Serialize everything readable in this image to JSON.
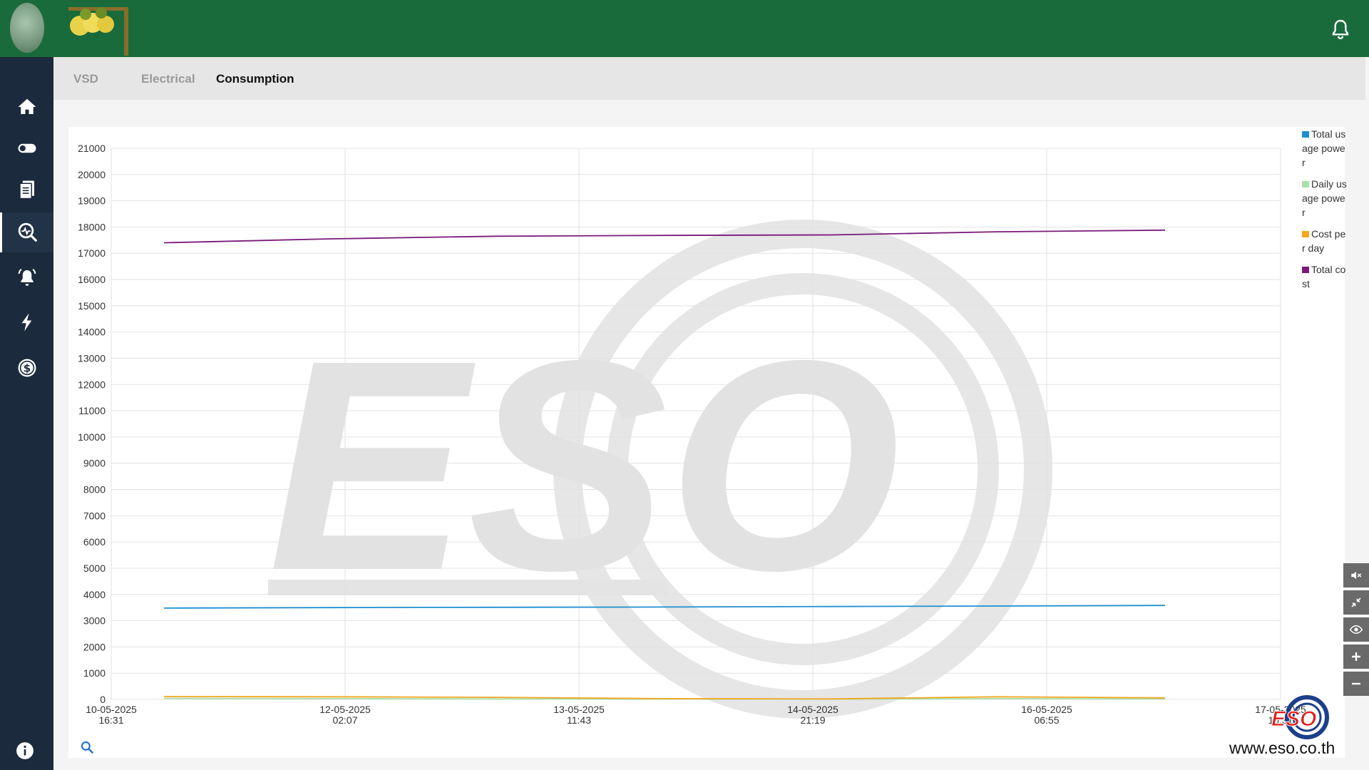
{
  "header": {
    "notifications_icon": "bell-icon",
    "colors": {
      "bar": "#1a6b3c"
    }
  },
  "sidebar": {
    "items": [
      {
        "icon": "home-icon"
      },
      {
        "icon": "toggle-icon"
      },
      {
        "icon": "document-icon"
      },
      {
        "icon": "monitor-search-icon",
        "active": true
      },
      {
        "icon": "alarm-bell-icon"
      },
      {
        "icon": "lightning-icon"
      },
      {
        "icon": "dollar-icon"
      }
    ],
    "info_icon": "info-icon"
  },
  "tabs": [
    {
      "label": "VSD",
      "active": false
    },
    {
      "label": "Electrical",
      "active": false
    },
    {
      "label": "Consumption",
      "active": true
    }
  ],
  "legend": [
    {
      "label": "Total usage power",
      "color": "#1f8fd0"
    },
    {
      "label": "Daily usage power",
      "color": "#a8e0a8"
    },
    {
      "label": "Cost per day",
      "color": "#f5a623"
    },
    {
      "label": "Total cost",
      "color": "#7a1a7a"
    }
  ],
  "chart_data": {
    "type": "line",
    "y_ticks": [
      "21000",
      "20000",
      "19000",
      "18000",
      "17000",
      "16000",
      "15000",
      "14000",
      "13000",
      "12000",
      "11000",
      "10000",
      "9000",
      "8000",
      "7000",
      "6000",
      "5000",
      "4000",
      "3000",
      "2000",
      "1000",
      "0"
    ],
    "ylim": [
      0,
      21000
    ],
    "x_ticks": [
      {
        "date": "10-05-2025",
        "time": "16:31"
      },
      {
        "date": "12-05-2025",
        "time": "02:07"
      },
      {
        "date": "13-05-2025",
        "time": "11:43"
      },
      {
        "date": "14-05-2025",
        "time": "21:19"
      },
      {
        "date": "16-05-2025",
        "time": "06:55"
      },
      {
        "date": "17-05-2025",
        "time": "16:31"
      }
    ],
    "x": [
      "11-05-2025",
      "12-05-2025",
      "13-05-2025",
      "14-05-2025",
      "15-05-2025",
      "16-05-2025",
      "17-05-2025"
    ],
    "series": [
      {
        "name": "Total usage power",
        "color": "#1f8fd0",
        "values": [
          3480,
          3500,
          3510,
          3520,
          3540,
          3560,
          3580
        ]
      },
      {
        "name": "Daily usage power",
        "color": "#a8e0a8",
        "values": [
          40,
          30,
          20,
          10,
          10,
          30,
          20
        ]
      },
      {
        "name": "Cost per day",
        "color": "#f5a623",
        "values": [
          110,
          100,
          80,
          30,
          20,
          100,
          60
        ]
      },
      {
        "name": "Total cost",
        "color": "#7a1a7a",
        "values": [
          17400,
          17550,
          17650,
          17680,
          17700,
          17820,
          17880
        ]
      }
    ],
    "grid": true,
    "legend_position": "right"
  },
  "tools": [
    "mute-icon",
    "collapse-icon",
    "eye-icon",
    "plus-icon",
    "minus-icon"
  ],
  "footer": {
    "brand": "ESO",
    "url": "www.eso.co.th",
    "zoom_icon": "search-icon"
  }
}
